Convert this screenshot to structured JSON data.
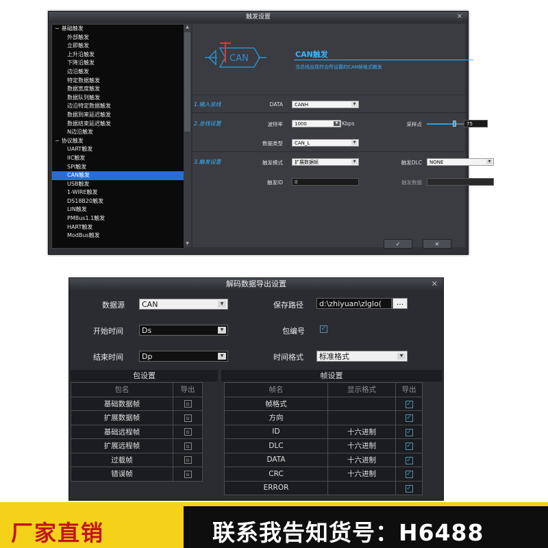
{
  "trigger_dialog": {
    "title": "触发设置",
    "close_glyph": "✕",
    "tree": [
      {
        "label": "基础触发",
        "level": 0,
        "expand": "−"
      },
      {
        "label": "外部触发",
        "level": 1
      },
      {
        "label": "立即触发",
        "level": 1
      },
      {
        "label": "上升沿触发",
        "level": 1
      },
      {
        "label": "下降沿触发",
        "level": 1
      },
      {
        "label": "边沿触发",
        "level": 1
      },
      {
        "label": "特定数据触发",
        "level": 1
      },
      {
        "label": "数据宽度触发",
        "level": 1
      },
      {
        "label": "数据队列触发",
        "level": 1
      },
      {
        "label": "边沿特定数据触发",
        "level": 1
      },
      {
        "label": "数据到来延迟触发",
        "level": 1
      },
      {
        "label": "数据结束延迟触发",
        "level": 1
      },
      {
        "label": "N边沿触发",
        "level": 1
      },
      {
        "label": "协议触发",
        "level": 0,
        "expand": "−"
      },
      {
        "label": "UART触发",
        "level": 1
      },
      {
        "label": "IIC触发",
        "level": 1
      },
      {
        "label": "SPI触发",
        "level": 1
      },
      {
        "label": "CAN触发",
        "level": 1,
        "selected": true
      },
      {
        "label": "USB触发",
        "level": 1
      },
      {
        "label": "1-WIRE触发",
        "level": 1
      },
      {
        "label": "DS18B20触发",
        "level": 1
      },
      {
        "label": "LIN触发",
        "level": 1
      },
      {
        "label": "PMBus1.1触发",
        "level": 1
      },
      {
        "label": "HART触发",
        "level": 1
      },
      {
        "label": "ModBus触发",
        "level": 1
      }
    ],
    "logo_text": "CAN",
    "heading": "CAN触发",
    "description": "当总线出现符合所设置的CAN帧格式触发",
    "sections": {
      "input_bus": "1.输入总线",
      "bus_settings": "2.总线设置",
      "trigger_settings": "3.触发设置"
    },
    "fields": {
      "data_label": "DATA",
      "data_value": "CANH",
      "baud_label": "波特率",
      "baud_value": "1000",
      "baud_unit": "Kbps",
      "sample_label": "采样点",
      "sample_value": "75",
      "sample_unit": "%",
      "sample_level": 0.75,
      "data_type_label": "数据类型",
      "data_type_value": "CAN_L",
      "trigger_mode_label": "触发模式",
      "trigger_mode_value": "扩展数据帧",
      "dlc_label": "触发DLC",
      "dlc_value": "NONE",
      "trigger_id_label": "触发ID",
      "trigger_id_value": "0",
      "trigger_data_label": "触发数据",
      "trigger_data_value": ""
    },
    "ok_glyph": "✓",
    "cancel_glyph": "✕"
  },
  "export_dialog": {
    "title": "解码数据导出设置",
    "close_glyph": "✕",
    "source_label": "数据源",
    "source_value": "CAN",
    "start_label": "开始时间",
    "start_value": "Ds",
    "end_label": "结束时间",
    "end_value": "Dp",
    "save_path_label": "保存路径",
    "save_path_value": "d:\\zhiyuan\\zlglo(",
    "browse_label": "...",
    "packet_no_label": "包编号",
    "packet_no_checked": true,
    "time_format_label": "时间格式",
    "time_format_value": "标准格式",
    "packet_settings": {
      "title": "包设置",
      "headers": [
        "包名",
        "导出"
      ],
      "rows": [
        {
          "name": "基础数据帧",
          "export": false
        },
        {
          "name": "扩展数据帧",
          "export": false
        },
        {
          "name": "基础远程帧",
          "export": false
        },
        {
          "name": "扩展远程帧",
          "export": false
        },
        {
          "name": "过载帧",
          "export": false
        },
        {
          "name": "错误帧",
          "export": false
        }
      ]
    },
    "frame_settings": {
      "title": "帧设置",
      "headers": [
        "帧名",
        "显示格式",
        "导出"
      ],
      "rows": [
        {
          "name": "帧格式",
          "format": "",
          "export": true
        },
        {
          "name": "方向",
          "format": "",
          "export": true
        },
        {
          "name": "ID",
          "format": "十六进制",
          "export": true
        },
        {
          "name": "DLC",
          "format": "十六进制",
          "export": true
        },
        {
          "name": "DATA",
          "format": "十六进制",
          "export": true
        },
        {
          "name": "CRC",
          "format": "十六进制",
          "export": true
        },
        {
          "name": "ERROR",
          "format": "",
          "export": true
        }
      ]
    }
  },
  "banner": {
    "left_text": "厂家直销",
    "right_text": "联系我告知货号：H6488",
    "accent_color": "#f5d21a",
    "left_text_color": "#c0161b"
  }
}
